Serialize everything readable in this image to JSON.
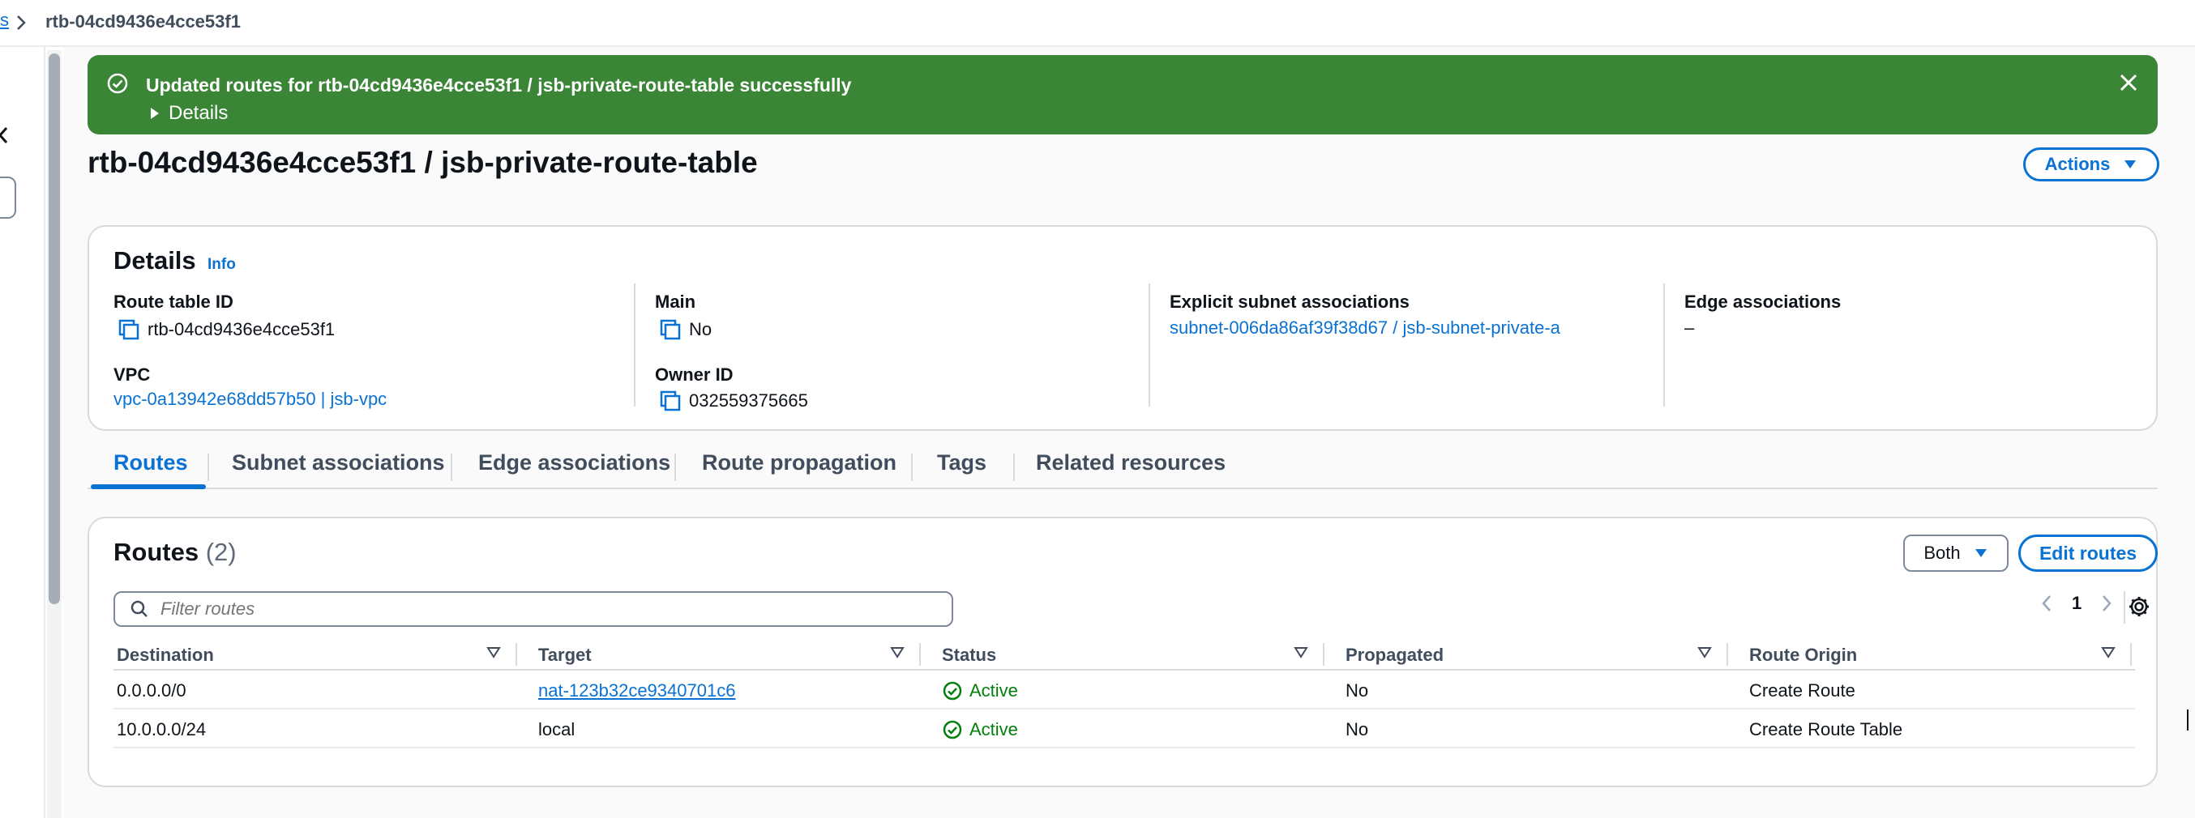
{
  "breadcrumb": {
    "parent_fragment": "s",
    "current": "rtb-04cd9436e4cce53f1"
  },
  "flash": {
    "message": "Updated routes for rtb-04cd9436e4cce53f1 / jsb-private-route-table successfully",
    "details_label": "Details",
    "color": "#3a8536"
  },
  "page": {
    "title": "rtb-04cd9436e4cce53f1 / jsb-private-route-table",
    "actions_label": "Actions"
  },
  "details": {
    "title": "Details",
    "info_label": "Info",
    "route_table_id_label": "Route table ID",
    "route_table_id": "rtb-04cd9436e4cce53f1",
    "vpc_label": "VPC",
    "vpc": "vpc-0a13942e68dd57b50 | jsb-vpc",
    "main_label": "Main",
    "main": "No",
    "owner_id_label": "Owner ID",
    "owner_id": "032559375665",
    "explicit_label": "Explicit subnet associations",
    "explicit": "subnet-006da86af39f38d67 / jsb-subnet-private-a",
    "edge_label": "Edge associations",
    "edge": "–"
  },
  "tabs": [
    {
      "label": "Routes",
      "active": true
    },
    {
      "label": "Subnet associations"
    },
    {
      "label": "Edge associations"
    },
    {
      "label": "Route propagation"
    },
    {
      "label": "Tags"
    },
    {
      "label": "Related resources"
    }
  ],
  "routes": {
    "title": "Routes",
    "count": "(2)",
    "select_value": "Both",
    "edit_label": "Edit routes",
    "filter_placeholder": "Filter routes",
    "page_number": "1",
    "columns": [
      "Destination",
      "Target",
      "Status",
      "Propagated",
      "Route Origin"
    ],
    "rows": [
      {
        "destination": "0.0.0.0/0",
        "target": "nat-123b32ce9340701c6",
        "status": "Active",
        "propagated": "No",
        "origin": "Create Route"
      },
      {
        "destination": "10.0.0.0/24",
        "target": "local",
        "status": "Active",
        "propagated": "No",
        "origin": "Create Route Table"
      }
    ]
  },
  "colors": {
    "accent": "#0972d3",
    "success": "#037f0c"
  }
}
